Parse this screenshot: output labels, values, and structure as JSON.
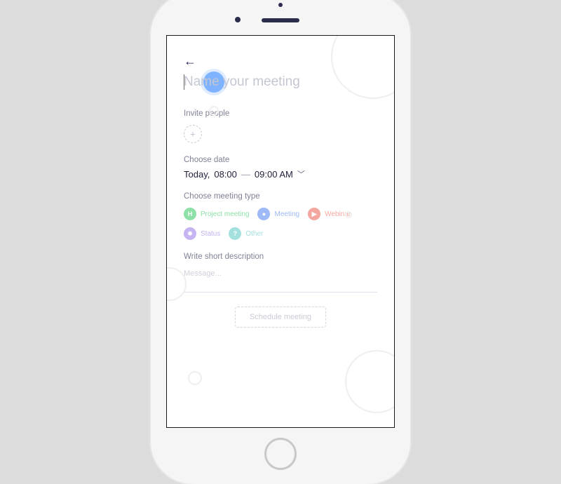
{
  "header": {
    "back_icon": "←",
    "title_placeholder": "Name your meeting",
    "title_value": ""
  },
  "invite": {
    "label": "Invite people"
  },
  "date": {
    "label": "Choose date",
    "prefix": "Today,",
    "start": "08:00",
    "sep": "—",
    "end": "09:00 AM"
  },
  "type": {
    "label": "Choose meeting type",
    "options": [
      {
        "label": "Project meeting",
        "icon": "H",
        "color": "green"
      },
      {
        "label": "Meeting",
        "icon": "●",
        "color": "blue"
      },
      {
        "label": "Webinar",
        "icon": "▶",
        "color": "red"
      },
      {
        "label": "Status",
        "icon": "✸",
        "color": "purple"
      },
      {
        "label": "Other",
        "icon": "?",
        "color": "teal"
      }
    ]
  },
  "description": {
    "label": "Write short description",
    "placeholder": "Message..."
  },
  "submit": {
    "label": "Schedule meeting"
  }
}
